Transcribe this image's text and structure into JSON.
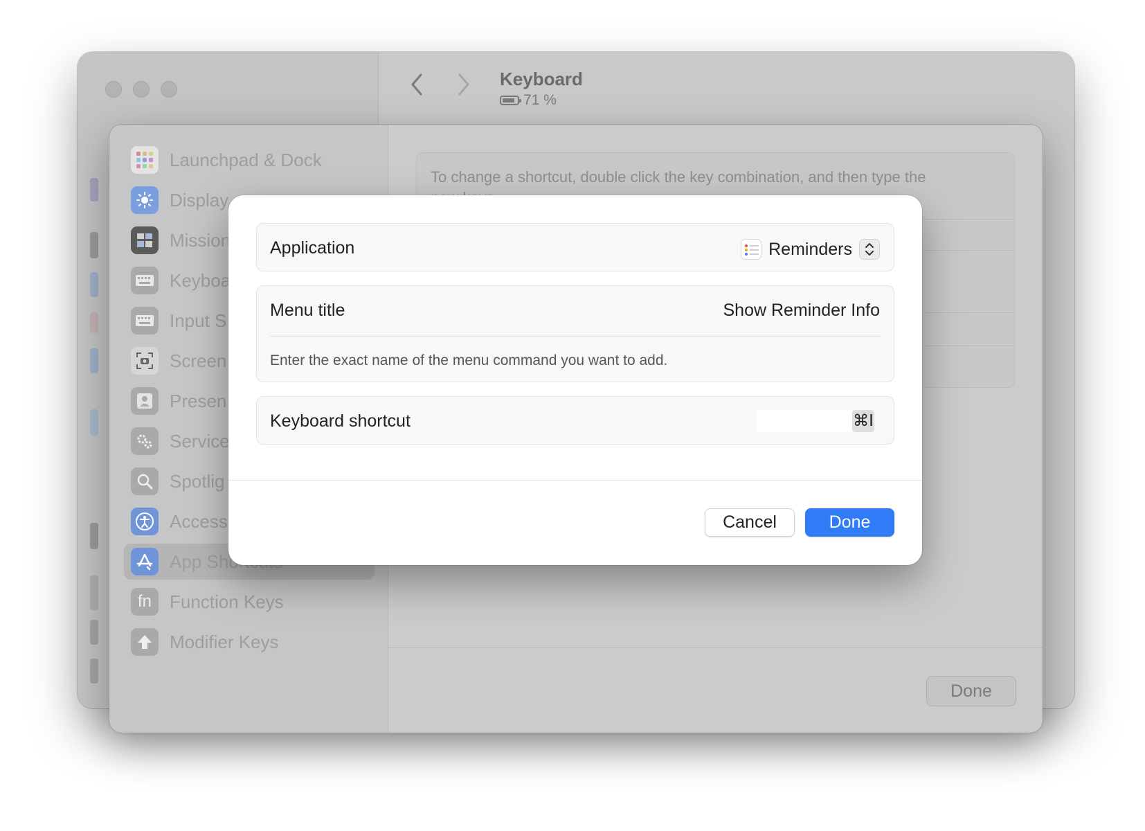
{
  "window": {
    "title": "Keyboard",
    "battery_text": "71 %"
  },
  "sheet": {
    "sidebar_items": [
      {
        "label": "Launchpad & Dock",
        "icon": "launchpad-icon"
      },
      {
        "label": "Display",
        "icon": "display-icon"
      },
      {
        "label": "Mission",
        "icon": "mission-control-icon"
      },
      {
        "label": "Keyboa",
        "icon": "keyboard-icon"
      },
      {
        "label": "Input S",
        "icon": "input-sources-icon"
      },
      {
        "label": "Screen",
        "icon": "screenshot-icon"
      },
      {
        "label": "Presen",
        "icon": "presenter-icon"
      },
      {
        "label": "Service",
        "icon": "services-icon"
      },
      {
        "label": "Spotlig",
        "icon": "spotlight-icon"
      },
      {
        "label": "Access",
        "icon": "accessibility-icon"
      },
      {
        "label": "App Shortcuts",
        "icon": "app-store-icon"
      },
      {
        "label": "Function Keys",
        "icon": "fn-icon"
      },
      {
        "label": "Modifier Keys",
        "icon": "modifier-up-arrow-icon"
      }
    ],
    "fn_icon_text": "fn",
    "selected_item": "App Shortcuts",
    "info_text": "To change a shortcut, double click the key combination, and then type the",
    "info_text_cut": "new keys.",
    "done_label": "Done"
  },
  "dialog": {
    "application_label": "Application",
    "application_value": "Reminders",
    "menu_title_label": "Menu title",
    "menu_title_value": "Show Reminder Info",
    "menu_title_hint": "Enter the exact name of the menu command you want to add.",
    "shortcut_label": "Keyboard shortcut",
    "shortcut_value": "⌘I",
    "cancel_label": "Cancel",
    "done_label": "Done"
  },
  "colors": {
    "accent": "#2f7cf6",
    "dialog_bg": "#ffffff",
    "dimmed_bg": "#c9c9c9"
  }
}
